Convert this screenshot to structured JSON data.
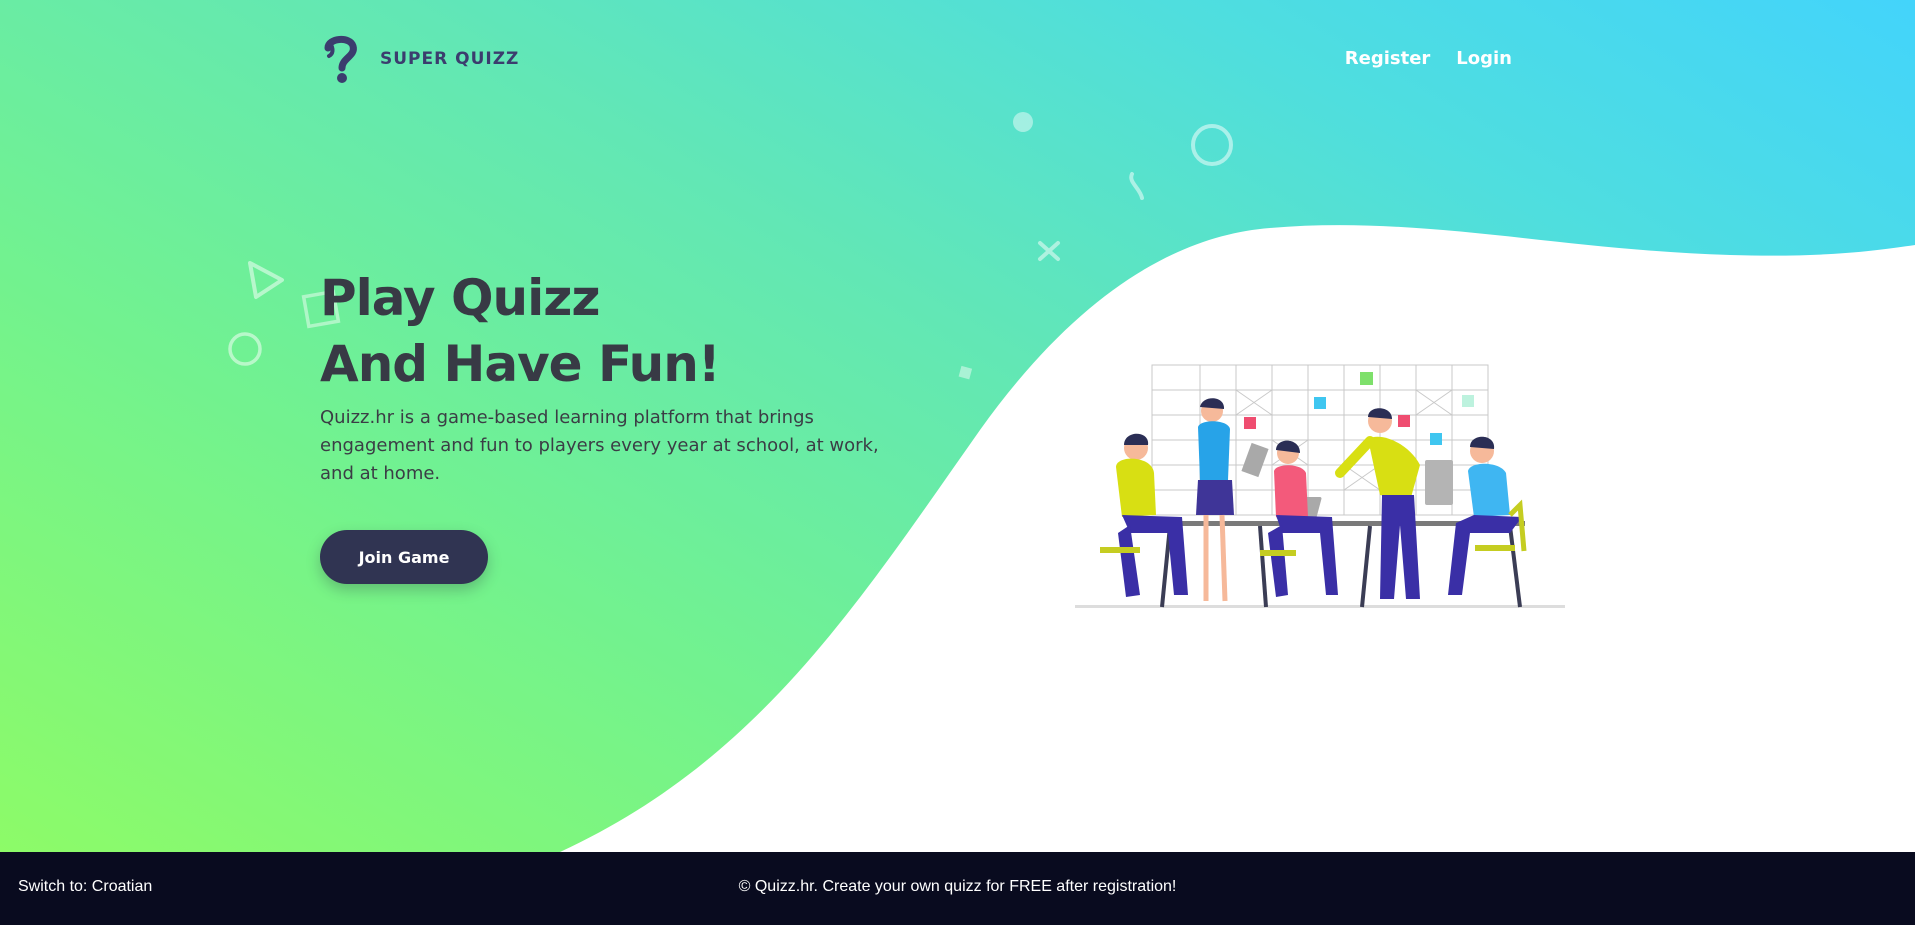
{
  "header": {
    "logo_text": "SUPER QUIZZ",
    "logo_icon": "question-mark-icon",
    "nav": {
      "register": "Register",
      "login": "Login"
    }
  },
  "hero": {
    "title_line1": "Play Quizz",
    "title_line2": "And Have Fun!",
    "description": "Quizz.hr is a game-based learning platform that brings engagement and fun to players every year at school, at work, and at home.",
    "join_button": "Join Game"
  },
  "footer": {
    "language_switch": "Switch to: Croatian",
    "copyright": "© Quizz.hr. Create your own quizz for FREE after registration!"
  },
  "colors": {
    "gradient_start": "#8dfb68",
    "gradient_end": "#43d4fb",
    "title_text": "#383a45",
    "button_bg": "#303452",
    "footer_bg": "#090b1f",
    "logo_color": "#3b3d6e"
  },
  "illustration": {
    "icon": "team-meeting-illustration"
  }
}
